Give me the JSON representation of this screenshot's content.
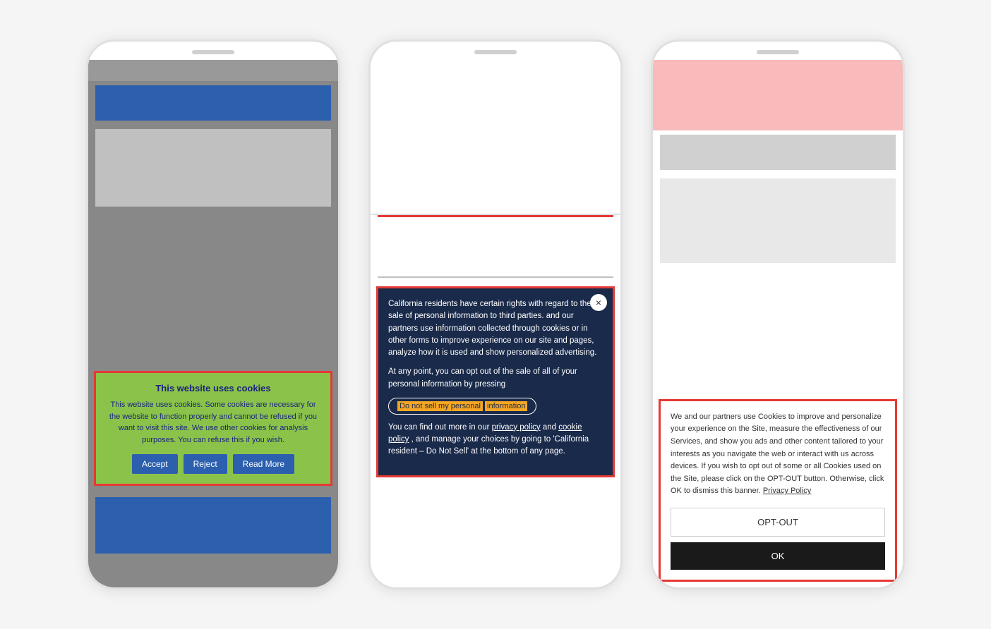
{
  "phone1": {
    "speaker_label": "speaker",
    "cookie_title": "This website uses cookies",
    "cookie_desc": "This website uses cookies. Some cookies are necessary for the website to function properly and cannot be refused if you want to visit this site. We use other cookies for analysis purposes. You can refuse this if you wish.",
    "accept_label": "Accept",
    "reject_label": "Reject",
    "read_more_label": "Read More"
  },
  "phone2": {
    "speaker_label": "speaker",
    "close_icon": "×",
    "para1": "California residents have certain rights with regard to the sale of personal information to third parties.",
    "para1_continued": "and our partners use information collected through cookies or in other forms to improve experience on our site and pages, analyze how it is used and show personalized advertising.",
    "para2": "At any point, you can opt out of the sale of all of your personal information by pressing",
    "dont_sell_label": "Do not sell my personal",
    "dont_sell_highlight": "information",
    "para3": "You can find out more in our",
    "privacy_policy": "privacy policy",
    "and": "and",
    "cookie_policy": "cookie policy",
    "para3_end": ", and manage your choices by going to 'California resident – Do Not Sell' at the bottom of any page."
  },
  "phone3": {
    "speaker_label": "speaker",
    "desc": "We and our partners use Cookies to improve and personalize your experience on the Site, measure the effectiveness of our Services, and show you ads and other content tailored to your interests as you navigate the web or interact with us across devices. If you wish to opt out of some or all Cookies used on the Site, please click on the OPT-OUT button. Otherwise, click OK to dismiss this banner.",
    "privacy_policy_label": "Privacy Policy",
    "opt_out_label": "OPT-OUT",
    "ok_label": "OK"
  }
}
